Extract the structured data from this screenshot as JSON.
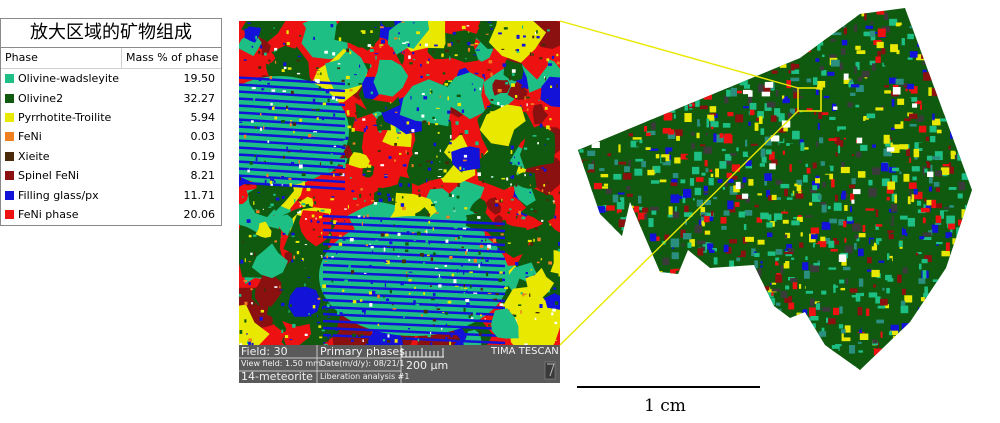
{
  "legend": {
    "title": "放大区域的矿物组成",
    "col_phase": "Phase",
    "col_mass": "Mass % of phase",
    "rows": [
      {
        "name": "Olivine-wadsleyite",
        "value": "19.50",
        "color": "#1dbf85"
      },
      {
        "name": "Olivine2",
        "value": "32.27",
        "color": "#0f5a0f"
      },
      {
        "name": "Pyrrhotite-Troilite",
        "value": "5.94",
        "color": "#e8e800"
      },
      {
        "name": "FeNi",
        "value": "0.03",
        "color": "#f07f1f"
      },
      {
        "name": "Xieite",
        "value": "0.19",
        "color": "#4a2a0a"
      },
      {
        "name": "Spinel FeNi",
        "value": "8.21",
        "color": "#8b1010"
      },
      {
        "name": "Filling glass/px",
        "value": "11.71",
        "color": "#1212d8"
      },
      {
        "name": "FeNi phase",
        "value": "20.06",
        "color": "#ee1111"
      }
    ]
  },
  "status": {
    "field": "Field: 30",
    "view_field": "View field: 1.50 mm",
    "sample": "14-meteorite",
    "phases": "Primary phases",
    "date": "Date(m/d/y): 08/21/1",
    "analysis": "Liberation analysis #1",
    "scale": "200 μm",
    "instrument": "TIMA TESCAN"
  },
  "scale_bar": {
    "label": "1 cm"
  },
  "colors": {
    "callout": "#e8e800",
    "strip_bg": "#5a5a5a"
  }
}
